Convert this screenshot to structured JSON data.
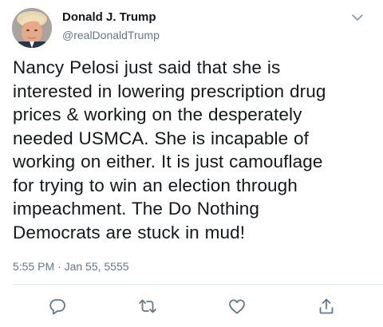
{
  "author": {
    "display_name": "Donald J. Trump",
    "handle": "@realDonaldTrump",
    "avatar_icon": "profile-photo"
  },
  "tweet": {
    "lines": [
      "Nancy Pelosi just said that she is",
      "interested in lowering prescription drug",
      "prices & working on the desperately",
      "needed USMCA. She is incapable of",
      "working on either. It is just camouflage",
      "for trying to win an election through",
      "impeachment. The Do Nothing",
      "Democrats are stuck in mud!"
    ],
    "timestamp": "5:55 PM · Jan 55, 5555"
  },
  "actions": {
    "reply_icon": "reply-icon",
    "retweet_icon": "retweet-icon",
    "like_icon": "heart-icon",
    "share_icon": "share-icon"
  },
  "colors": {
    "text": "#14171a",
    "secondary": "#657786",
    "icon": "#657786",
    "divider": "#e6ecf0"
  }
}
